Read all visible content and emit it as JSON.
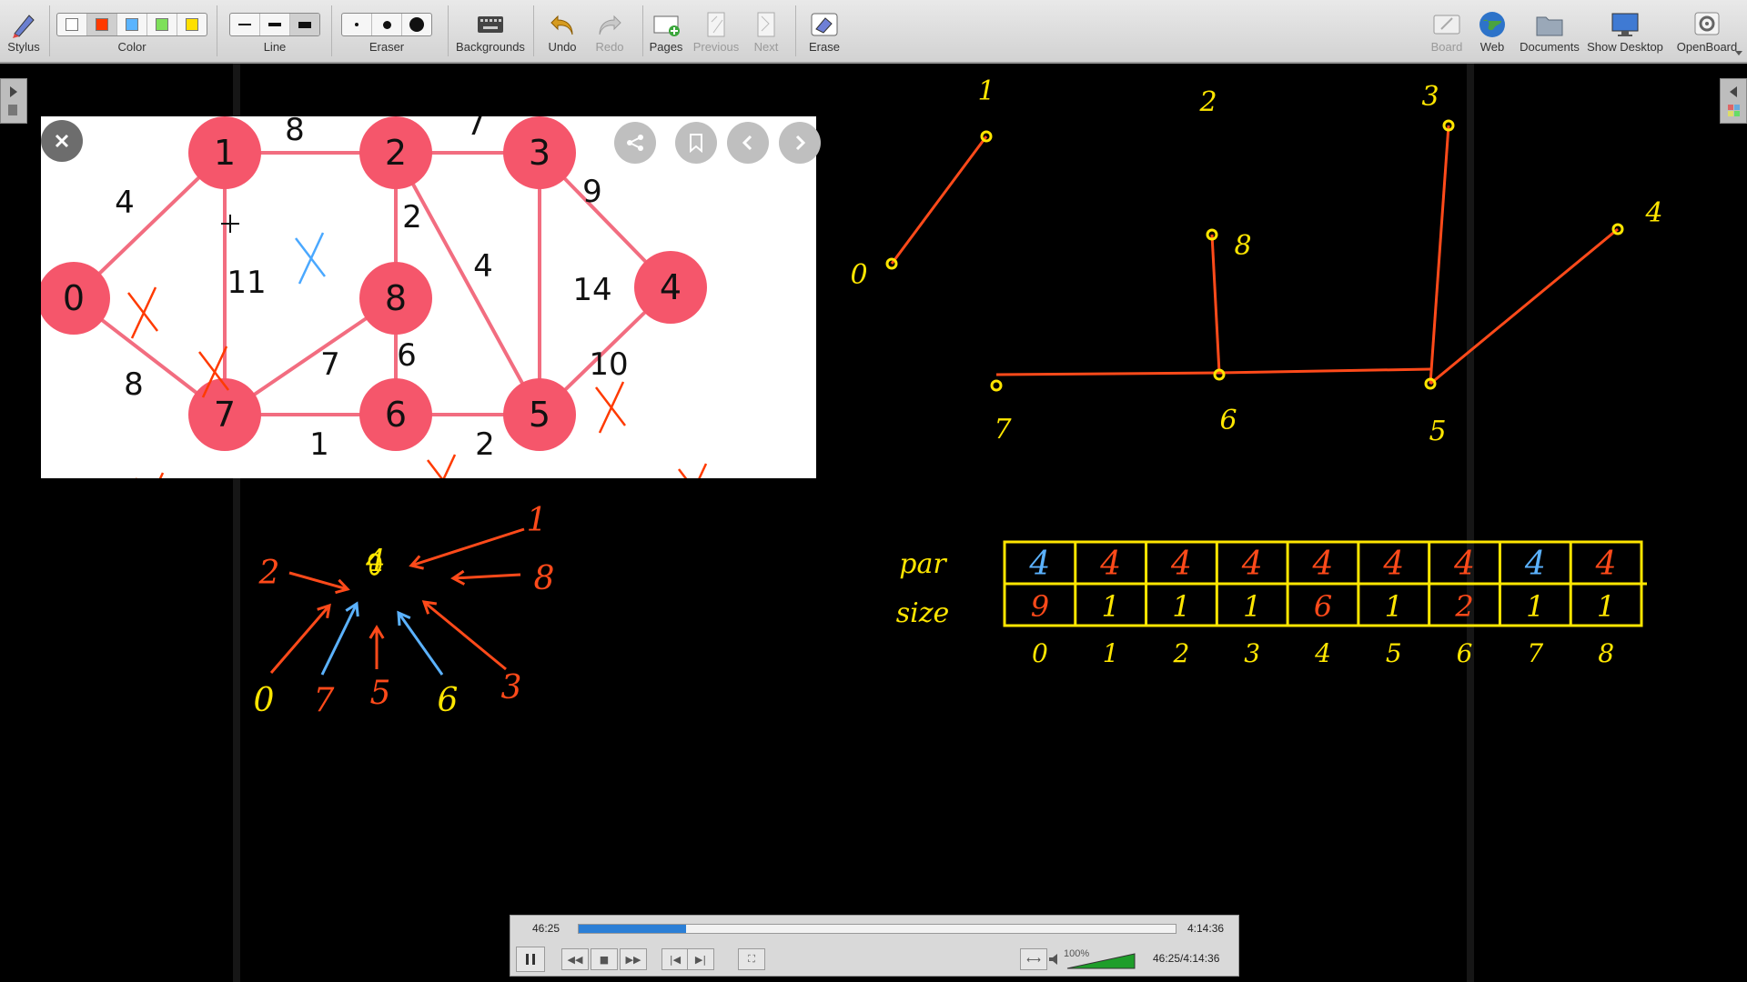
{
  "toolbar": {
    "stylus": "Stylus",
    "color": "Color",
    "line": "Line",
    "eraser": "Eraser",
    "backgrounds": "Backgrounds",
    "undo": "Undo",
    "redo": "Redo",
    "pages": "Pages",
    "previous": "Previous",
    "next": "Next",
    "erase": "Erase",
    "board": "Board",
    "web": "Web",
    "documents": "Documents",
    "show_desktop": "Show Desktop",
    "openboard": "OpenBoard"
  },
  "palette": [
    "#ffffff",
    "#ff3a00",
    "#5ab4ff",
    "#7ee05a",
    "#ffe000"
  ],
  "graph_image": {
    "nodes": [
      "0",
      "1",
      "2",
      "3",
      "4",
      "5",
      "6",
      "7",
      "8"
    ],
    "weights": [
      "4",
      "8",
      "7",
      "9",
      "11",
      "2",
      "4",
      "14",
      "8",
      "7",
      "6",
      "10",
      "1",
      "2"
    ],
    "node_color": "#f5566b"
  },
  "drawing": {
    "tree_labels": [
      "1",
      "0",
      "2",
      "8",
      "6",
      "7",
      "3",
      "4",
      "5"
    ],
    "arrow_left_labels": [
      "2",
      "0",
      "7",
      "5",
      "6",
      "3",
      "8",
      "1"
    ],
    "arrow_center": "4",
    "table": {
      "row_labels": [
        "par",
        "size"
      ],
      "par": [
        "4",
        "4",
        "4",
        "4",
        "4",
        "4",
        "4",
        "4",
        "4"
      ],
      "size": [
        "9",
        "1",
        "1",
        "1",
        "6",
        "1",
        "2",
        "1",
        "1"
      ],
      "index": [
        "0",
        "1",
        "2",
        "3",
        "4",
        "5",
        "6",
        "7",
        "8"
      ]
    }
  },
  "player": {
    "elapsed": "46:25",
    "total": "4:14:36",
    "zoom": "100%",
    "position": "46:25/4:14:36",
    "progress": 0.18
  }
}
